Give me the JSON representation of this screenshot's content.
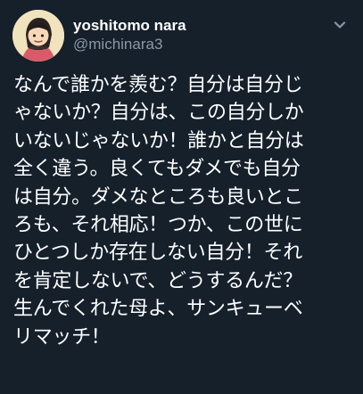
{
  "tweet": {
    "author": {
      "display_name": "yoshitomo nara",
      "username": "@michinara3"
    },
    "text_lines": [
      "なんで誰かを羨む？自分は自分じ",
      "ゃないか？自分は、この自分しか",
      "いないじゃないか！誰かと自分は",
      "全く違う。良くてもダメでも自分",
      "は自分。ダメなところも良いとこ",
      "ろも、それ相応！つか、この世に",
      "ひとつしか存在しない自分！それ",
      "を肯定しないで、どうするんだ？",
      "生んでくれた母よ、サンキューベ",
      "リマッチ！"
    ]
  },
  "icons": {
    "avatar": "avatar-image",
    "menu": "chevron-down-icon"
  },
  "colors": {
    "background": "#15202b",
    "primary_text": "#ffffff",
    "secondary_text": "#8899a6"
  }
}
